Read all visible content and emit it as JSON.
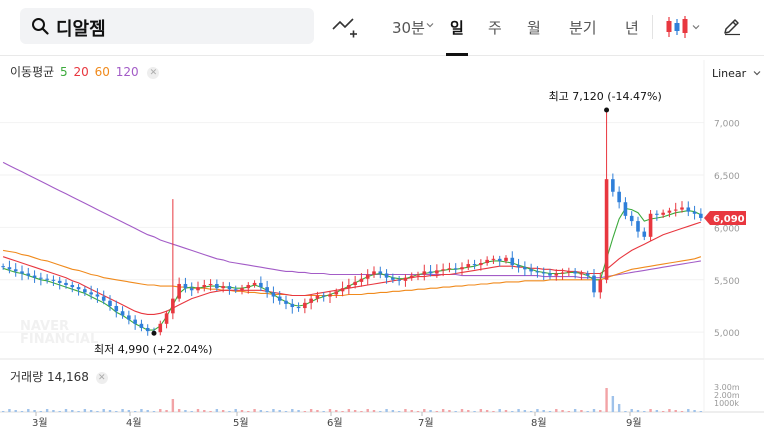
{
  "search": {
    "query": "디알젬"
  },
  "periods": {
    "interval": "30분",
    "day": "일",
    "week": "주",
    "month": "월",
    "quarter": "분기",
    "year": "년"
  },
  "legend": {
    "ma_title": "이동평균",
    "ma": [
      "5",
      "20",
      "60",
      "120"
    ],
    "volume_title": "거래량",
    "volume_value": "14,168"
  },
  "colors": {
    "up": "#e8373f",
    "down": "#2f7fd9",
    "ma5": "#3caa3c",
    "ma20": "#e8373f",
    "ma60": "#f08a1c",
    "ma120": "#a35cc7",
    "current_price_bg": "#e8373f"
  },
  "scale": "Linear",
  "watermark": [
    "NAVER",
    "FINANCIAL"
  ],
  "chart_data": {
    "type": "candlestick",
    "x_ticks": [
      "3월",
      "4월",
      "5월",
      "6월",
      "7월",
      "8월",
      "9월"
    ],
    "y_ticks": [
      "7,000",
      "6,500",
      "6,000",
      "5,500",
      "5,000"
    ],
    "volume_ticks": [
      "3.00m",
      "2.00m",
      "1000k"
    ],
    "ylim": [
      4830,
      7330
    ],
    "current_price": "6,090",
    "high_label": "최고 7,120 (-14.47%)",
    "low_label": "최저 4,990 (+22.04%)",
    "high_value": 7120,
    "low_value": 4990,
    "close_series": [
      5620,
      5600,
      5580,
      5560,
      5540,
      5520,
      5510,
      5500,
      5490,
      5470,
      5450,
      5430,
      5410,
      5380,
      5360,
      5340,
      5300,
      5250,
      5200,
      5160,
      5120,
      5080,
      5040,
      5010,
      5000,
      5080,
      5180,
      5320,
      5460,
      5420,
      5400,
      5430,
      5450,
      5460,
      5420,
      5440,
      5410,
      5400,
      5420,
      5450,
      5470,
      5430,
      5380,
      5340,
      5300,
      5270,
      5240,
      5230,
      5280,
      5320,
      5350,
      5340,
      5360,
      5390,
      5420,
      5450,
      5480,
      5510,
      5550,
      5580,
      5560,
      5520,
      5500,
      5490,
      5520,
      5540,
      5550,
      5580,
      5560,
      5590,
      5600,
      5610,
      5600,
      5620,
      5650,
      5640,
      5660,
      5690,
      5700,
      5680,
      5710,
      5640,
      5620,
      5600,
      5580,
      5570,
      5560,
      5540,
      5560,
      5570,
      5580,
      5560,
      5560,
      5540,
      5380,
      5500,
      6460,
      6340,
      6240,
      6110,
      6060,
      5960,
      5910,
      6130,
      6120,
      6140,
      6160,
      6170,
      6190,
      6150,
      6130,
      6090
    ],
    "ma5": [
      5610,
      5590,
      5570,
      5560,
      5540,
      5520,
      5500,
      5490,
      5470,
      5450,
      5430,
      5410,
      5390,
      5370,
      5340,
      5310,
      5280,
      5240,
      5190,
      5160,
      5120,
      5080,
      5050,
      5020,
      5020,
      5060,
      5150,
      5260,
      5370,
      5420,
      5430,
      5420,
      5430,
      5440,
      5440,
      5430,
      5430,
      5420,
      5420,
      5430,
      5450,
      5430,
      5400,
      5360,
      5320,
      5290,
      5260,
      5250,
      5260,
      5290,
      5320,
      5340,
      5360,
      5380,
      5410,
      5440,
      5470,
      5500,
      5530,
      5550,
      5560,
      5540,
      5520,
      5510,
      5510,
      5530,
      5550,
      5560,
      5570,
      5580,
      5590,
      5600,
      5600,
      5610,
      5620,
      5630,
      5650,
      5670,
      5680,
      5680,
      5670,
      5660,
      5640,
      5620,
      5600,
      5580,
      5570,
      5560,
      5560,
      5560,
      5570,
      5570,
      5560,
      5540,
      5500,
      5500,
      5700,
      5900,
      6080,
      6180,
      6170,
      6140,
      6060,
      6080,
      6090,
      6100,
      6120,
      6140,
      6150,
      6160,
      6150,
      6120
    ],
    "ma20": [
      5720,
      5700,
      5680,
      5660,
      5640,
      5620,
      5600,
      5580,
      5560,
      5540,
      5520,
      5490,
      5470,
      5440,
      5410,
      5380,
      5350,
      5320,
      5290,
      5260,
      5230,
      5200,
      5180,
      5170,
      5170,
      5180,
      5200,
      5230,
      5260,
      5290,
      5320,
      5340,
      5360,
      5380,
      5390,
      5400,
      5400,
      5400,
      5400,
      5400,
      5400,
      5400,
      5390,
      5380,
      5370,
      5360,
      5350,
      5350,
      5350,
      5360,
      5370,
      5380,
      5390,
      5400,
      5410,
      5420,
      5430,
      5440,
      5450,
      5460,
      5470,
      5480,
      5490,
      5500,
      5510,
      5520,
      5530,
      5530,
      5540,
      5540,
      5550,
      5550,
      5560,
      5570,
      5580,
      5590,
      5600,
      5610,
      5620,
      5630,
      5630,
      5630,
      5620,
      5620,
      5610,
      5610,
      5600,
      5600,
      5590,
      5590,
      5580,
      5580,
      5570,
      5560,
      5560,
      5560,
      5600,
      5650,
      5700,
      5740,
      5780,
      5810,
      5840,
      5870,
      5900,
      5930,
      5950,
      5970,
      5990,
      6010,
      6030,
      6050
    ],
    "ma60": [
      5780,
      5770,
      5760,
      5740,
      5730,
      5710,
      5690,
      5680,
      5660,
      5640,
      5620,
      5600,
      5590,
      5570,
      5550,
      5540,
      5520,
      5510,
      5500,
      5490,
      5480,
      5470,
      5460,
      5450,
      5450,
      5440,
      5440,
      5440,
      5430,
      5430,
      5420,
      5420,
      5420,
      5410,
      5410,
      5400,
      5400,
      5390,
      5390,
      5380,
      5380,
      5370,
      5370,
      5360,
      5360,
      5360,
      5350,
      5350,
      5350,
      5350,
      5350,
      5350,
      5350,
      5350,
      5350,
      5360,
      5360,
      5360,
      5370,
      5370,
      5380,
      5380,
      5390,
      5390,
      5400,
      5400,
      5410,
      5410,
      5420,
      5420,
      5430,
      5430,
      5440,
      5440,
      5450,
      5450,
      5460,
      5460,
      5470,
      5470,
      5480,
      5480,
      5480,
      5490,
      5490,
      5490,
      5490,
      5500,
      5500,
      5500,
      5500,
      5500,
      5500,
      5500,
      5500,
      5500,
      5520,
      5540,
      5560,
      5580,
      5600,
      5610,
      5620,
      5630,
      5640,
      5650,
      5660,
      5670,
      5680,
      5690,
      5700,
      5720
    ],
    "ma120": [
      6620,
      6590,
      6560,
      6530,
      6500,
      6470,
      6440,
      6410,
      6380,
      6350,
      6320,
      6290,
      6260,
      6230,
      6200,
      6170,
      6140,
      6110,
      6080,
      6050,
      6020,
      5990,
      5960,
      5930,
      5910,
      5880,
      5860,
      5840,
      5820,
      5800,
      5780,
      5760,
      5740,
      5720,
      5700,
      5690,
      5670,
      5660,
      5650,
      5640,
      5630,
      5620,
      5610,
      5600,
      5590,
      5580,
      5580,
      5570,
      5570,
      5560,
      5560,
      5560,
      5550,
      5550,
      5550,
      5550,
      5550,
      5550,
      5550,
      5550,
      5550,
      5550,
      5550,
      5550,
      5550,
      5550,
      5550,
      5550,
      5550,
      5550,
      5550,
      5550,
      5550,
      5540,
      5540,
      5540,
      5540,
      5540,
      5540,
      5540,
      5540,
      5540,
      5540,
      5540,
      5540,
      5540,
      5530,
      5530,
      5530,
      5530,
      5530,
      5530,
      5520,
      5520,
      5520,
      5520,
      5530,
      5540,
      5550,
      5560,
      5570,
      5580,
      5590,
      5600,
      5610,
      5620,
      5630,
      5640,
      5650,
      5660,
      5670,
      5680
    ]
  }
}
